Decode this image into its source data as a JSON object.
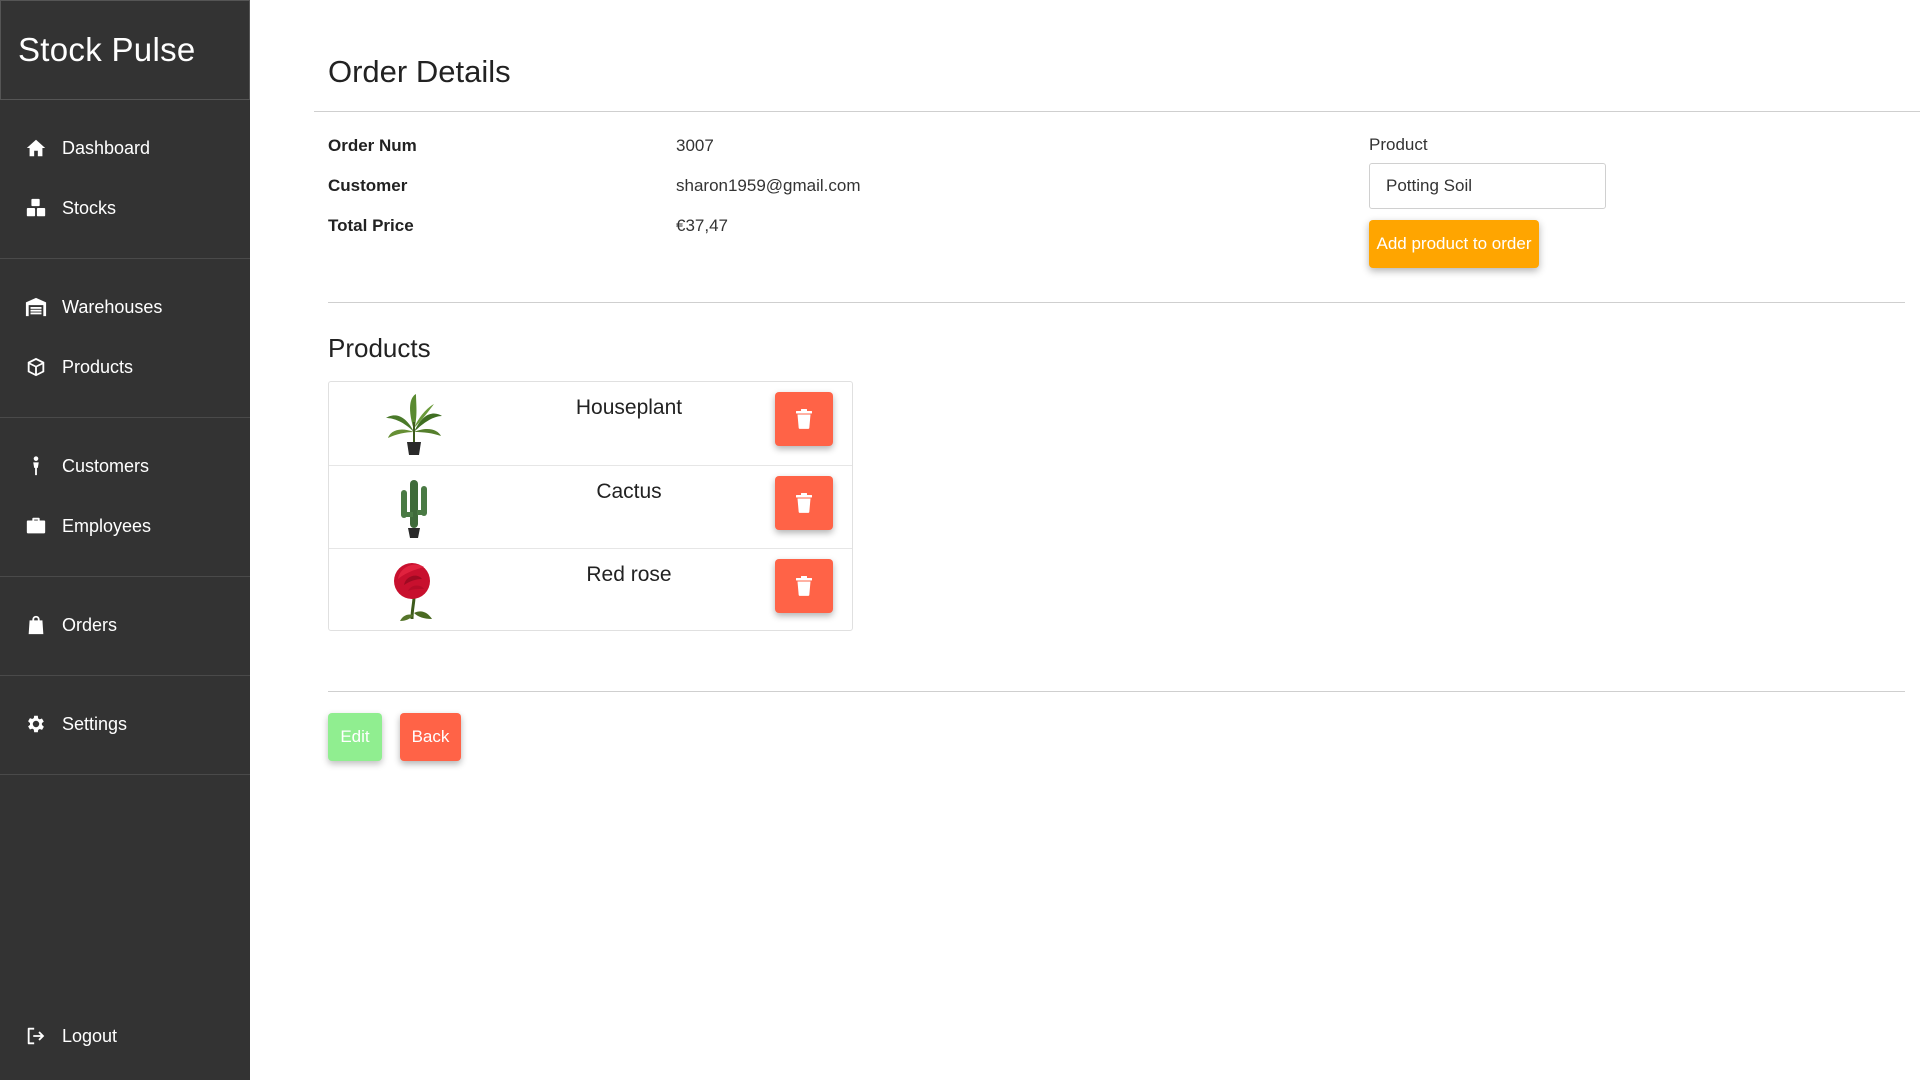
{
  "app": {
    "brand": "Stock Pulse"
  },
  "sidebar": {
    "groups": [
      [
        {
          "label": "Dashboard",
          "icon": "home-icon"
        },
        {
          "label": "Stocks",
          "icon": "boxes-icon"
        }
      ],
      [
        {
          "label": "Warehouses",
          "icon": "warehouse-icon"
        },
        {
          "label": "Products",
          "icon": "box-icon"
        }
      ],
      [
        {
          "label": "Customers",
          "icon": "person-icon"
        },
        {
          "label": "Employees",
          "icon": "briefcase-icon"
        }
      ],
      [
        {
          "label": "Orders",
          "icon": "shopping-bag-icon"
        }
      ],
      [
        {
          "label": "Settings",
          "icon": "gear-icon"
        }
      ]
    ],
    "logout": {
      "label": "Logout",
      "icon": "logout-icon"
    }
  },
  "order": {
    "title": "Order Details",
    "fields": [
      {
        "label": "Order Num",
        "value": "3007"
      },
      {
        "label": "Customer",
        "value": "sharon1959@gmail.com"
      },
      {
        "label": "Total Price",
        "value": "€37,47"
      }
    ],
    "product_label": "Product",
    "product_value": "Potting Soil",
    "add_button": "Add product to order"
  },
  "products": {
    "title": "Products",
    "items": [
      {
        "name": "Houseplant",
        "image": "houseplant"
      },
      {
        "name": "Cactus",
        "image": "cactus"
      },
      {
        "name": "Red rose",
        "image": "red-rose"
      }
    ]
  },
  "actions": {
    "edit": "Edit",
    "back": "Back"
  },
  "colors": {
    "sidebar_bg": "#333333",
    "accent_orange": "#ffa500",
    "danger": "#ff6347",
    "edit_green": "#90ee90"
  }
}
